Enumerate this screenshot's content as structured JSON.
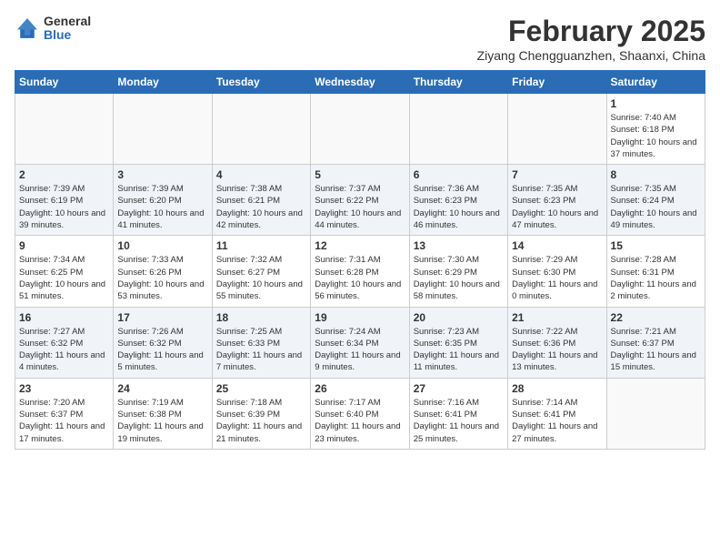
{
  "header": {
    "logo_general": "General",
    "logo_blue": "Blue",
    "title": "February 2025",
    "subtitle": "Ziyang Chengguanzhen, Shaanxi, China"
  },
  "days_of_week": [
    "Sunday",
    "Monday",
    "Tuesday",
    "Wednesday",
    "Thursday",
    "Friday",
    "Saturday"
  ],
  "weeks": [
    {
      "shade": "white",
      "days": [
        {
          "num": "",
          "info": ""
        },
        {
          "num": "",
          "info": ""
        },
        {
          "num": "",
          "info": ""
        },
        {
          "num": "",
          "info": ""
        },
        {
          "num": "",
          "info": ""
        },
        {
          "num": "",
          "info": ""
        },
        {
          "num": "1",
          "info": "Sunrise: 7:40 AM\nSunset: 6:18 PM\nDaylight: 10 hours and 37 minutes."
        }
      ]
    },
    {
      "shade": "shaded",
      "days": [
        {
          "num": "2",
          "info": "Sunrise: 7:39 AM\nSunset: 6:19 PM\nDaylight: 10 hours and 39 minutes."
        },
        {
          "num": "3",
          "info": "Sunrise: 7:39 AM\nSunset: 6:20 PM\nDaylight: 10 hours and 41 minutes."
        },
        {
          "num": "4",
          "info": "Sunrise: 7:38 AM\nSunset: 6:21 PM\nDaylight: 10 hours and 42 minutes."
        },
        {
          "num": "5",
          "info": "Sunrise: 7:37 AM\nSunset: 6:22 PM\nDaylight: 10 hours and 44 minutes."
        },
        {
          "num": "6",
          "info": "Sunrise: 7:36 AM\nSunset: 6:23 PM\nDaylight: 10 hours and 46 minutes."
        },
        {
          "num": "7",
          "info": "Sunrise: 7:35 AM\nSunset: 6:23 PM\nDaylight: 10 hours and 47 minutes."
        },
        {
          "num": "8",
          "info": "Sunrise: 7:35 AM\nSunset: 6:24 PM\nDaylight: 10 hours and 49 minutes."
        }
      ]
    },
    {
      "shade": "white",
      "days": [
        {
          "num": "9",
          "info": "Sunrise: 7:34 AM\nSunset: 6:25 PM\nDaylight: 10 hours and 51 minutes."
        },
        {
          "num": "10",
          "info": "Sunrise: 7:33 AM\nSunset: 6:26 PM\nDaylight: 10 hours and 53 minutes."
        },
        {
          "num": "11",
          "info": "Sunrise: 7:32 AM\nSunset: 6:27 PM\nDaylight: 10 hours and 55 minutes."
        },
        {
          "num": "12",
          "info": "Sunrise: 7:31 AM\nSunset: 6:28 PM\nDaylight: 10 hours and 56 minutes."
        },
        {
          "num": "13",
          "info": "Sunrise: 7:30 AM\nSunset: 6:29 PM\nDaylight: 10 hours and 58 minutes."
        },
        {
          "num": "14",
          "info": "Sunrise: 7:29 AM\nSunset: 6:30 PM\nDaylight: 11 hours and 0 minutes."
        },
        {
          "num": "15",
          "info": "Sunrise: 7:28 AM\nSunset: 6:31 PM\nDaylight: 11 hours and 2 minutes."
        }
      ]
    },
    {
      "shade": "shaded",
      "days": [
        {
          "num": "16",
          "info": "Sunrise: 7:27 AM\nSunset: 6:32 PM\nDaylight: 11 hours and 4 minutes."
        },
        {
          "num": "17",
          "info": "Sunrise: 7:26 AM\nSunset: 6:32 PM\nDaylight: 11 hours and 5 minutes."
        },
        {
          "num": "18",
          "info": "Sunrise: 7:25 AM\nSunset: 6:33 PM\nDaylight: 11 hours and 7 minutes."
        },
        {
          "num": "19",
          "info": "Sunrise: 7:24 AM\nSunset: 6:34 PM\nDaylight: 11 hours and 9 minutes."
        },
        {
          "num": "20",
          "info": "Sunrise: 7:23 AM\nSunset: 6:35 PM\nDaylight: 11 hours and 11 minutes."
        },
        {
          "num": "21",
          "info": "Sunrise: 7:22 AM\nSunset: 6:36 PM\nDaylight: 11 hours and 13 minutes."
        },
        {
          "num": "22",
          "info": "Sunrise: 7:21 AM\nSunset: 6:37 PM\nDaylight: 11 hours and 15 minutes."
        }
      ]
    },
    {
      "shade": "white",
      "days": [
        {
          "num": "23",
          "info": "Sunrise: 7:20 AM\nSunset: 6:37 PM\nDaylight: 11 hours and 17 minutes."
        },
        {
          "num": "24",
          "info": "Sunrise: 7:19 AM\nSunset: 6:38 PM\nDaylight: 11 hours and 19 minutes."
        },
        {
          "num": "25",
          "info": "Sunrise: 7:18 AM\nSunset: 6:39 PM\nDaylight: 11 hours and 21 minutes."
        },
        {
          "num": "26",
          "info": "Sunrise: 7:17 AM\nSunset: 6:40 PM\nDaylight: 11 hours and 23 minutes."
        },
        {
          "num": "27",
          "info": "Sunrise: 7:16 AM\nSunset: 6:41 PM\nDaylight: 11 hours and 25 minutes."
        },
        {
          "num": "28",
          "info": "Sunrise: 7:14 AM\nSunset: 6:41 PM\nDaylight: 11 hours and 27 minutes."
        },
        {
          "num": "",
          "info": ""
        }
      ]
    }
  ]
}
